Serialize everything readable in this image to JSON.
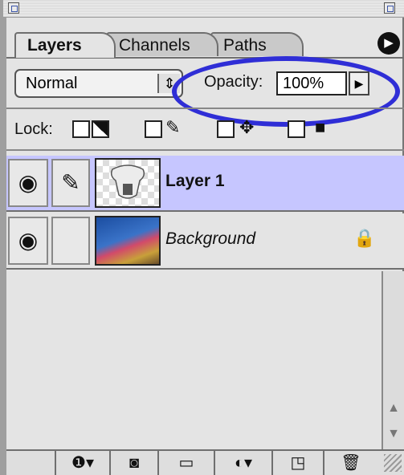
{
  "tabs": [
    "Layers",
    "Channels",
    "Paths"
  ],
  "blend_mode": {
    "value": "Normal"
  },
  "opacity": {
    "label": "Opacity:",
    "value": "100%"
  },
  "lock": {
    "label": "Lock:"
  },
  "layers": [
    {
      "name": "Layer 1",
      "selected": true,
      "visible": true
    },
    {
      "name": "Background",
      "selected": false,
      "visible": true,
      "locked": true
    }
  ],
  "colors": {
    "selected_row": "#c6c6ff",
    "panel_bg": "#e4e4e4",
    "highlight_ellipse": "#2f2ed6"
  },
  "icons": {
    "eye": "eye-icon",
    "brush": "brush-icon",
    "lock": "lock-icon",
    "panel_menu": "panel-menu-icon",
    "layer_style": "layer-style-icon",
    "mask": "mask-icon",
    "folder": "folder-icon",
    "adjustment": "adjustment-layer-icon",
    "new_layer": "new-layer-icon",
    "trash": "trash-icon"
  }
}
